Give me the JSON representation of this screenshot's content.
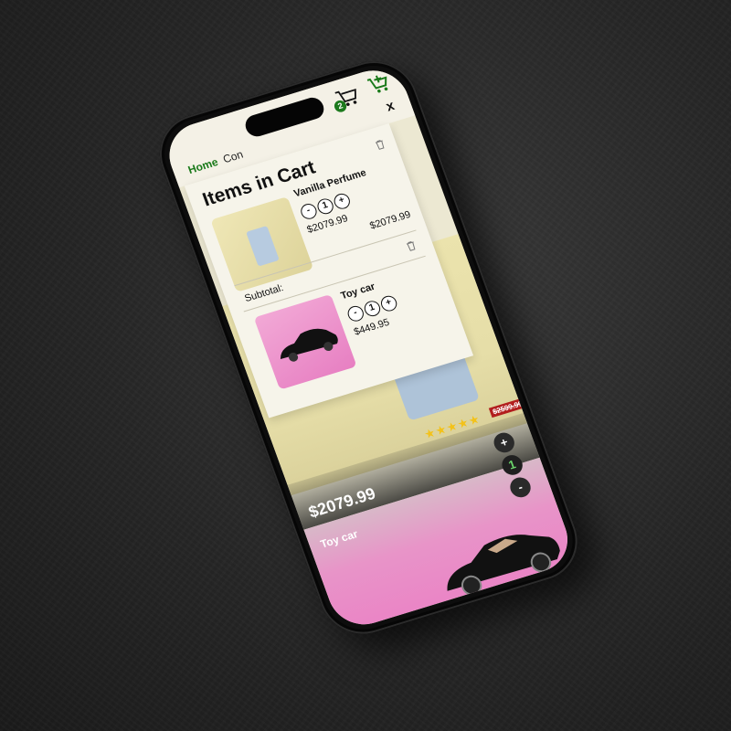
{
  "nav": {
    "home": "Home",
    "contact_partial": "Con",
    "cart_count": "2",
    "close": "x"
  },
  "cart": {
    "title": "Items in Cart",
    "items": [
      {
        "name": "Vanilla Perfume",
        "qty": "1",
        "unit_price": "$2079.99",
        "line_total": "$2079.99",
        "minus": "-",
        "plus": "+"
      },
      {
        "name": "Toy car",
        "qty": "1",
        "unit_price": "$449.95",
        "minus": "-",
        "plus": "+"
      }
    ],
    "subtotal_label": "Subtotal:"
  },
  "product": {
    "rating_stars": "★★★★★",
    "old_price": "$2599.99",
    "price": "$2079.99",
    "plus": "+",
    "count": "1",
    "minus": "-"
  },
  "next_product": {
    "title": "Toy car"
  },
  "colors": {
    "accent_green": "#1a7a1a",
    "sale_red": "#b21e1e",
    "star_yellow": "#f3c21a"
  }
}
